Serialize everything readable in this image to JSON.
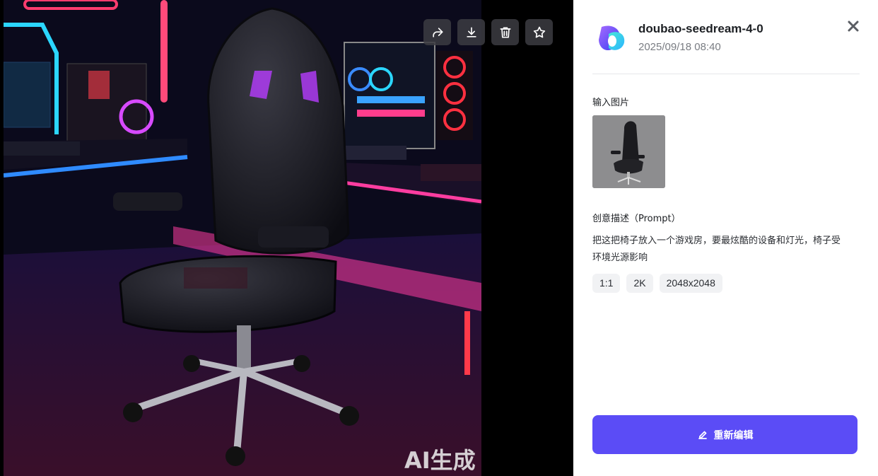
{
  "viewer": {
    "watermark": "AI生成",
    "toolbar": [
      {
        "icon": "share-icon"
      },
      {
        "icon": "download-icon"
      },
      {
        "icon": "trash-icon"
      },
      {
        "icon": "star-icon"
      }
    ]
  },
  "panel": {
    "model_name": "doubao-seedream-4-0",
    "timestamp": "2025/09/18 08:40",
    "close_icon": "close-icon",
    "input_label": "输入图片",
    "prompt_label": "创意描述（Prompt）",
    "prompt_text": "把这把椅子放入一个游戏房，要最炫酷的设备和灯光，椅子受环境光源影响",
    "tags": [
      "1:1",
      "2K",
      "2048x2048"
    ],
    "reedit_label": "重新编辑",
    "reedit_icon": "edit-icon"
  },
  "colors": {
    "accent": "#5b4cf6",
    "panel_bg": "#ffffff",
    "viewer_bg": "#000000"
  }
}
